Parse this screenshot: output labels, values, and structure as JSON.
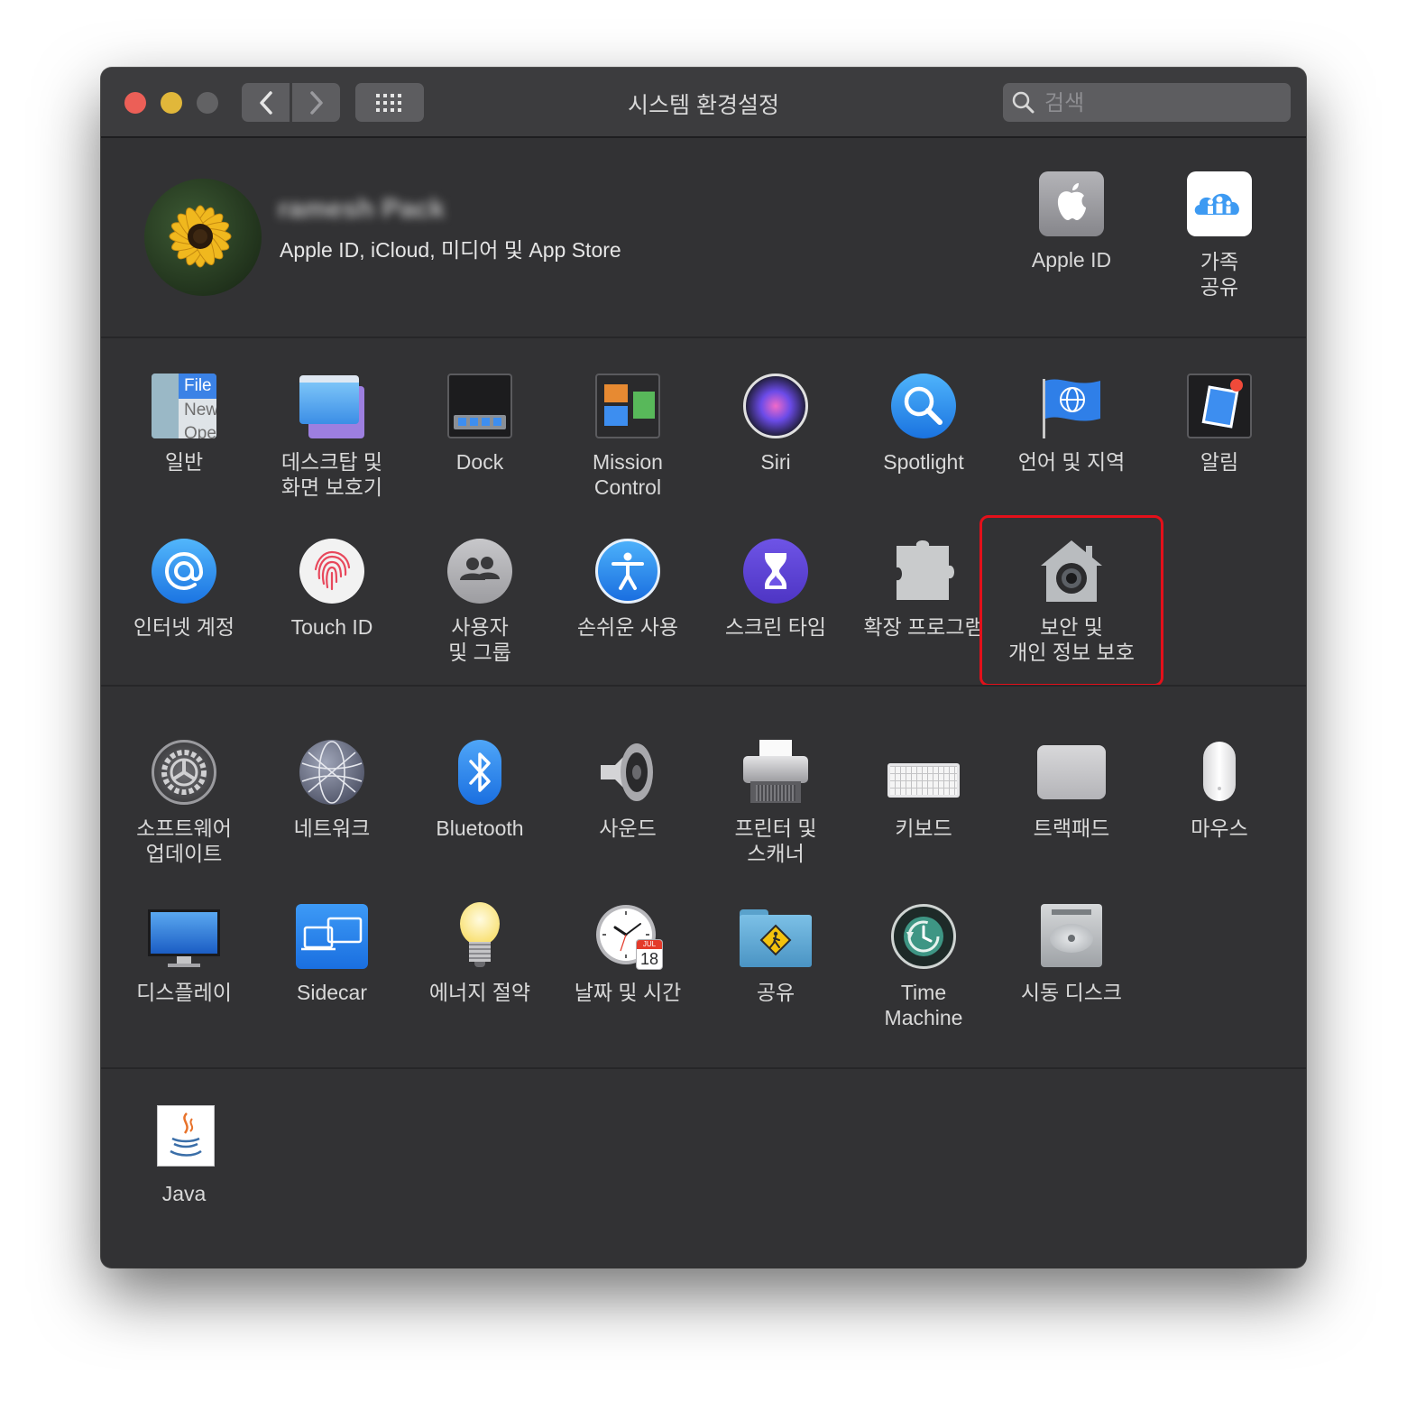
{
  "window": {
    "title": "시스템 환경설정",
    "search_placeholder": "검색"
  },
  "account": {
    "name": "ramesh Pack",
    "subtitle": "Apple ID, iCloud, 미디어 및 App Store",
    "apple_id_label": "Apple ID",
    "family_label": "가족\n공유"
  },
  "row1": [
    {
      "label": "일반"
    },
    {
      "label": "데스크탑 및\n화면 보호기"
    },
    {
      "label": "Dock"
    },
    {
      "label": "Mission\nControl"
    },
    {
      "label": "Siri"
    },
    {
      "label": "Spotlight"
    },
    {
      "label": "언어 및 지역"
    },
    {
      "label": "알림"
    }
  ],
  "general_icon_text": {
    "file": "File",
    "new": "New",
    "open": "Ope"
  },
  "row2": [
    {
      "label": "인터넷 계정"
    },
    {
      "label": "Touch ID"
    },
    {
      "label": "사용자\n및 그룹"
    },
    {
      "label": "손쉬운 사용"
    },
    {
      "label": "스크린 타임"
    },
    {
      "label": "확장 프로그램"
    },
    {
      "label": "보안 및\n개인 정보 보호"
    }
  ],
  "row3": [
    {
      "label": "소프트웨어\n업데이트"
    },
    {
      "label": "네트워크"
    },
    {
      "label": "Bluetooth"
    },
    {
      "label": "사운드"
    },
    {
      "label": "프린터 및\n스캐너"
    },
    {
      "label": "키보드"
    },
    {
      "label": "트랙패드"
    },
    {
      "label": "마우스"
    }
  ],
  "row4": [
    {
      "label": "디스플레이"
    },
    {
      "label": "Sidecar"
    },
    {
      "label": "에너지 절약"
    },
    {
      "label": "날짜 및 시간"
    },
    {
      "label": "공유"
    },
    {
      "label": "Time\nMachine"
    },
    {
      "label": "시동 디스크"
    }
  ],
  "calendar": {
    "month": "JUL",
    "day": "18"
  },
  "row5": [
    {
      "label": "Java"
    }
  ],
  "colors": {
    "window_bg": "#323234",
    "titlebar": "#3c3c3e",
    "highlight": "#e3101a",
    "close": "#ec5f57",
    "minimize": "#e1b73a",
    "zoom": "#626264"
  }
}
